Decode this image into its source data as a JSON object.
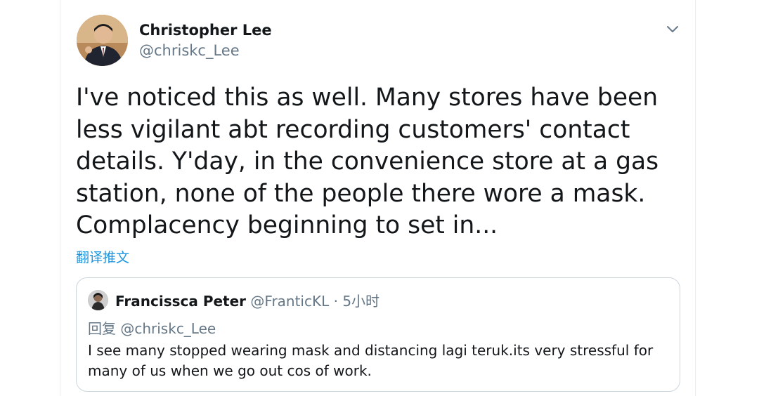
{
  "tweet": {
    "author_name": "Christopher Lee",
    "author_handle": "@chriskc_Lee",
    "text": "I've noticed this as well. Many stores have been less vigilant abt recording customers' contact details. Y'day, in the convenience store at a gas station, none of the people there wore a mask. Complacency beginning to set in...",
    "translate_label": "翻译推文",
    "menu_icon": "chevron-down-icon"
  },
  "quoted_tweet": {
    "author_name": "Francissca Peter",
    "author_handle": "@FranticKL",
    "separator": "·",
    "time": "5小时",
    "reply_label": "回复",
    "reply_to": "@chriskc_Lee",
    "text": "I see many stopped wearing mask and distancing lagi teruk.its very stressful for many of us when we go out cos of work."
  },
  "colors": {
    "link": "#1b95e0",
    "secondary_text": "#657786",
    "border": "#ccd6dd",
    "primary_text": "#14171a"
  }
}
